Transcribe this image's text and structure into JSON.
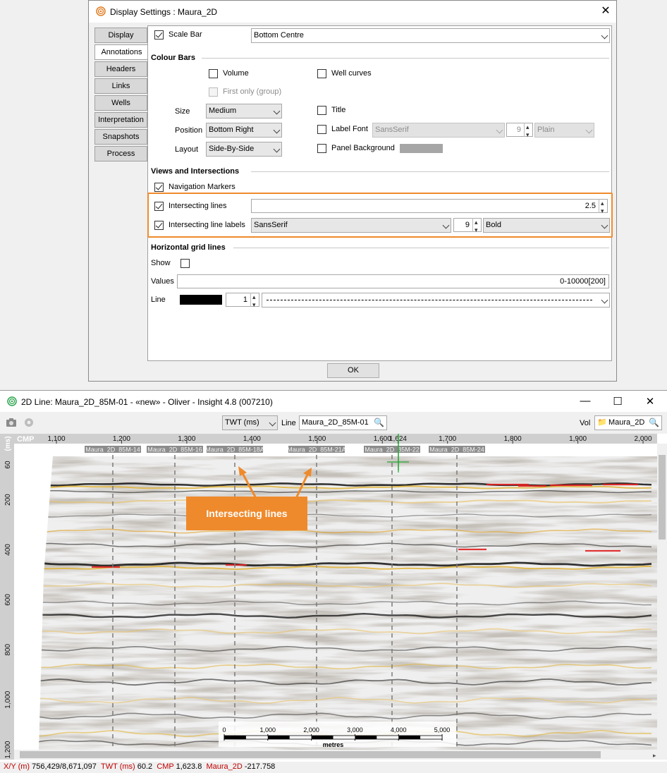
{
  "dialog": {
    "title": "Display Settings : Maura_2D",
    "close": "✕",
    "tabs": [
      "Display",
      "Annotations",
      "Headers",
      "Links",
      "Wells",
      "Interpretation",
      "Snapshots",
      "Process"
    ],
    "active_tab": "Annotations",
    "scale_bar": {
      "label": "Scale Bar",
      "checked": true,
      "position": "Bottom Centre"
    },
    "colour_bars": {
      "heading": "Colour Bars",
      "volume": "Volume",
      "well_curves": "Well curves",
      "first_only": "First only (group)",
      "size_label": "Size",
      "size_value": "Medium",
      "position_label": "Position",
      "position_value": "Bottom Right",
      "layout_label": "Layout",
      "layout_value": "Side-By-Side",
      "title": "Title",
      "label_font": "Label Font",
      "font_family": "SansSerif",
      "font_size": "9",
      "font_style": "Plain",
      "panel_background": "Panel Background",
      "panel_bg_color": "#a6a6a6"
    },
    "views": {
      "heading": "Views and Intersections",
      "navigation_markers": "Navigation Markers",
      "intersecting_lines": "Intersecting lines",
      "intersecting_lines_value": "2.5",
      "intersecting_line_labels": "Intersecting line labels",
      "label_font": "SansSerif",
      "label_size": "9",
      "label_style": "Bold"
    },
    "grid": {
      "heading": "Horizontal grid lines",
      "show": "Show",
      "values_label": "Values",
      "values_value": "0-10000[200]",
      "line_label": "Line",
      "line_width": "1",
      "line_color": "#000000"
    },
    "ok": "OK",
    "highlight_color": "#ef8a2c"
  },
  "viewer": {
    "title": "2D Line: Maura_2D_85M-01 - «new» - Oliver - Insight 4.8 (007210)",
    "minimize": "—",
    "maximize": "☐",
    "close": "✕",
    "domain_select": "TWT (ms)",
    "line_label": "Line",
    "line_value": "Maura_2D_85M-01",
    "vol_label": "Vol",
    "vol_value": "Maura_2D",
    "axis_title": "CMP",
    "cmp_ticks": [
      "1,100",
      "1,200",
      "1,300",
      "1,400",
      "1,500",
      "1,600",
      "1,624",
      "1,700",
      "1,800",
      "1,900",
      "2,000"
    ],
    "intersection_labels": [
      "Maura_2D_85M-14",
      "Maura_2D_85M-16",
      "Maura_2D_85M-18A",
      "Maura_2D_85M-21A",
      "Maura_2D_85M-22",
      "Maura_2D_85M-24"
    ],
    "time_ticks": [
      "60",
      "200",
      "400",
      "600",
      "800",
      "1,000",
      "1,200"
    ],
    "time_axis_label": "(ms)",
    "callout": "Intersecting lines",
    "callout_color": "#ef8a2c",
    "scalebar_ticks": [
      "0",
      "1,000",
      "2,000",
      "3,000",
      "4,000",
      "5,000"
    ],
    "scalebar_unit": "metres"
  },
  "status": {
    "xy_key": "X/Y (m)",
    "xy_val": "756,429/8,671,097",
    "twt_key": "TWT (ms)",
    "twt_val": "60.2",
    "cmp_key": "CMP",
    "cmp_val": "1,623.8",
    "vol_key": "Maura_2D",
    "vol_val": "-217.758"
  }
}
